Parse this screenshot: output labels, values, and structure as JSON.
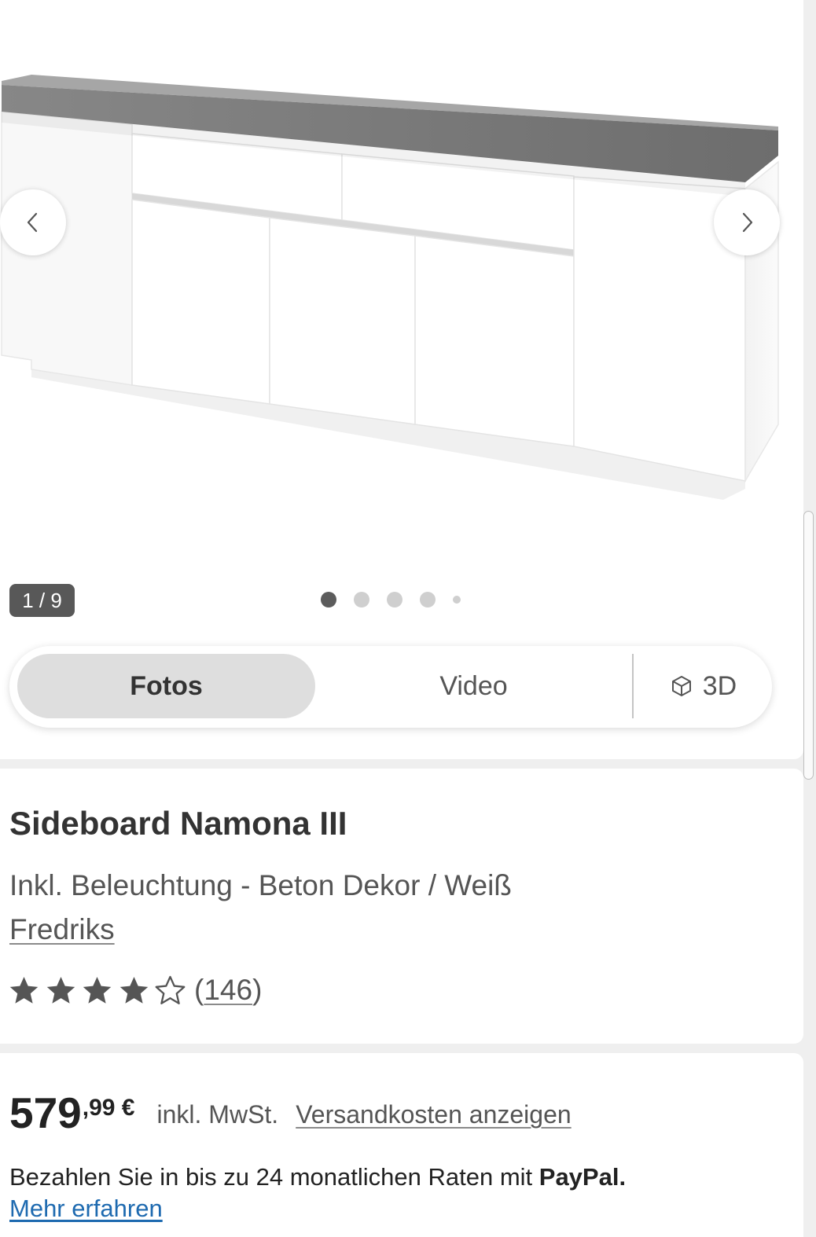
{
  "gallery": {
    "prev_icon": "chevron-left-icon",
    "next_icon": "chevron-right-icon",
    "counter": "1 / 9",
    "pagination": {
      "visible_dots": 5,
      "active_index": 0
    },
    "media_tabs": [
      {
        "label": "Fotos",
        "active": true
      },
      {
        "label": "Video",
        "active": false
      },
      {
        "label": "3D",
        "active": false,
        "icon": "cube-icon"
      }
    ]
  },
  "product": {
    "title": "Sideboard Namona III",
    "subtitle": "Inkl. Beleuchtung - Beton Dekor / Weiß",
    "brand": "Fredriks",
    "rating": {
      "value": 4,
      "max": 5,
      "count_open": "(",
      "count": "146",
      "count_close": ")"
    }
  },
  "price": {
    "main": "579",
    "fraction": ",99 €",
    "tax_note": "inkl. MwSt.",
    "shipping_link": "Versandkosten anzeigen"
  },
  "paypal": {
    "text": "Bezahlen Sie in bis zu 24 monatlichen Raten mit ",
    "brand": "PayPal.",
    "link": "Mehr erfahren"
  },
  "colors": {
    "page_bg": "#efefef",
    "badge_bg": "#585858",
    "active_tab_bg": "#dedede",
    "link_blue": "#1e6ab0",
    "star": "#555555",
    "dot_active": "#5c5c5c",
    "dot_inactive": "#cfcfcf"
  }
}
